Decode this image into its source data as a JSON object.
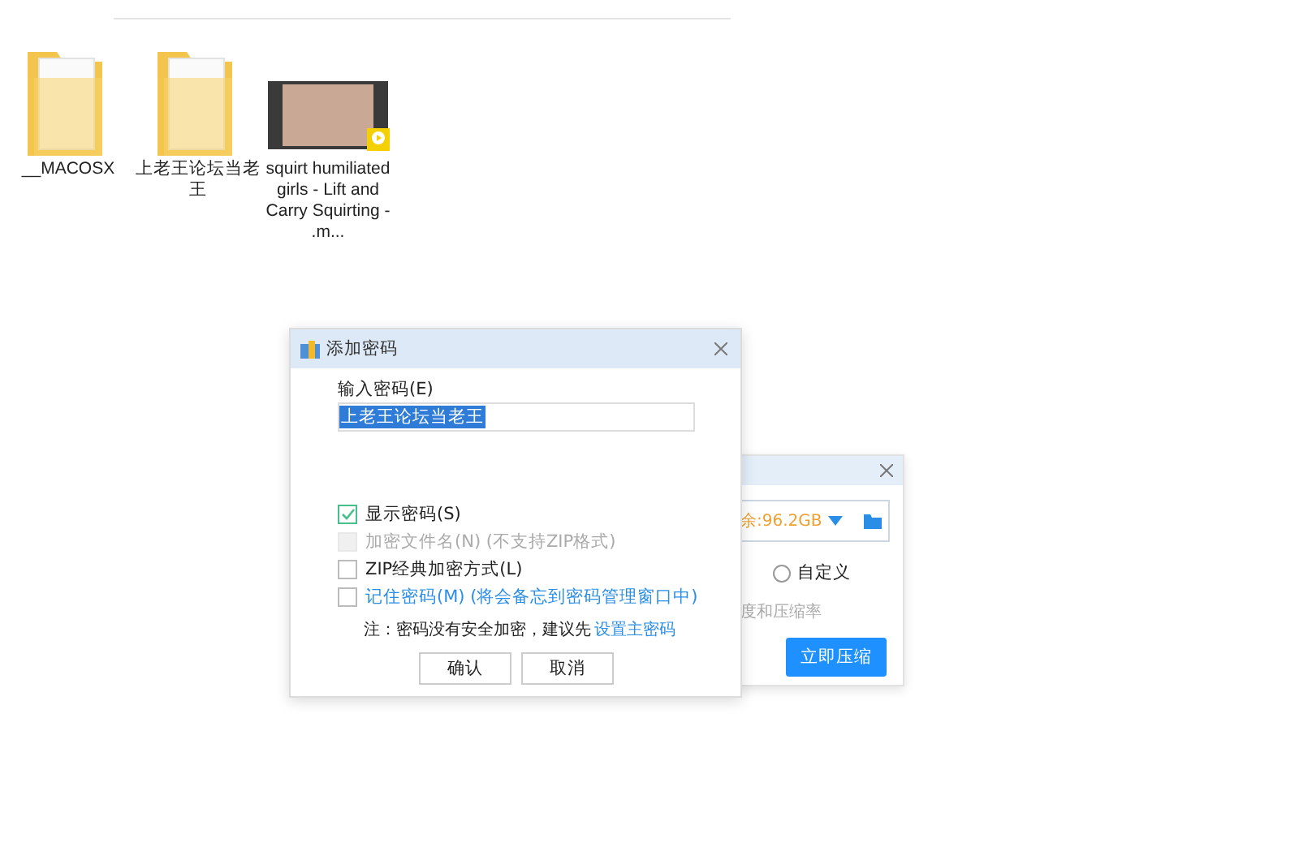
{
  "explorer": {
    "items": [
      {
        "name": "__MACOSX",
        "kind": "folder"
      },
      {
        "name": "上老王论坛当老王",
        "kind": "folder"
      },
      {
        "name": "squirt humiliated girls - Lift and Carry Squirting - .m...",
        "kind": "video"
      }
    ]
  },
  "compress_window": {
    "space_field": "余:96.2GB",
    "options": [
      {
        "label": "自定义",
        "selected": false
      }
    ],
    "hint": "度和压缩率",
    "button": "立即压缩"
  },
  "password_dialog": {
    "title": "添加密码",
    "password_label": "输入密码(E)",
    "password_value": "上老王论坛当老王",
    "value_highlighted": true,
    "options": [
      {
        "label": "显示密码(S)",
        "checked": true,
        "disabled": false,
        "kind": "plain"
      },
      {
        "label": "加密文件名(N) (不支持ZIP格式)",
        "checked": false,
        "disabled": true,
        "kind": "plain"
      },
      {
        "label": "ZIP经典加密方式(L)",
        "checked": false,
        "disabled": false,
        "kind": "plain"
      },
      {
        "label": "记住密码(M) (将会备忘到密码管理窗口中)",
        "checked": false,
        "disabled": false,
        "kind": "link"
      }
    ],
    "note": "注：密码没有安全加密，建议先",
    "note_link": "设置主密码",
    "buttons": [
      "确认",
      "取消"
    ]
  }
}
